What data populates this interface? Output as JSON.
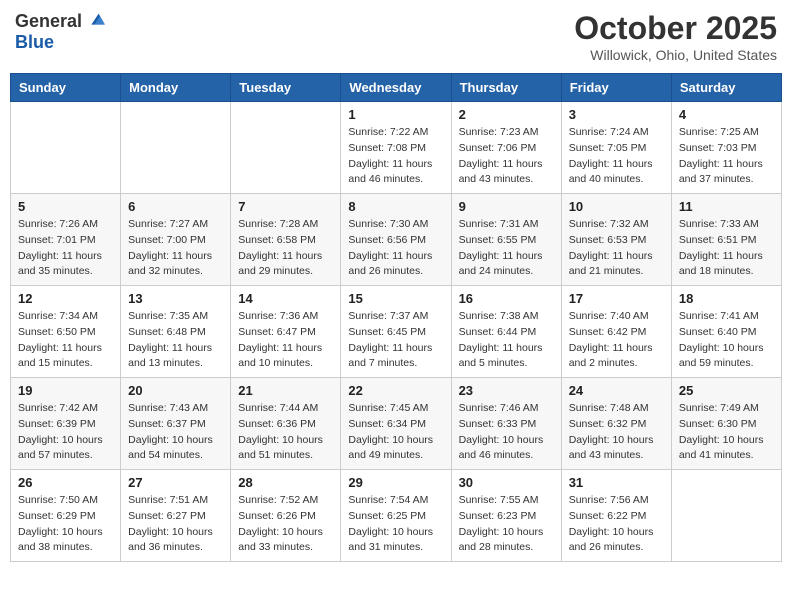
{
  "logo": {
    "general": "General",
    "blue": "Blue"
  },
  "header": {
    "month": "October 2025",
    "location": "Willowick, Ohio, United States"
  },
  "weekdays": [
    "Sunday",
    "Monday",
    "Tuesday",
    "Wednesday",
    "Thursday",
    "Friday",
    "Saturday"
  ],
  "weeks": [
    [
      {
        "day": "",
        "sunrise": "",
        "sunset": "",
        "daylight": ""
      },
      {
        "day": "",
        "sunrise": "",
        "sunset": "",
        "daylight": ""
      },
      {
        "day": "",
        "sunrise": "",
        "sunset": "",
        "daylight": ""
      },
      {
        "day": "1",
        "sunrise": "Sunrise: 7:22 AM",
        "sunset": "Sunset: 7:08 PM",
        "daylight": "Daylight: 11 hours and 46 minutes."
      },
      {
        "day": "2",
        "sunrise": "Sunrise: 7:23 AM",
        "sunset": "Sunset: 7:06 PM",
        "daylight": "Daylight: 11 hours and 43 minutes."
      },
      {
        "day": "3",
        "sunrise": "Sunrise: 7:24 AM",
        "sunset": "Sunset: 7:05 PM",
        "daylight": "Daylight: 11 hours and 40 minutes."
      },
      {
        "day": "4",
        "sunrise": "Sunrise: 7:25 AM",
        "sunset": "Sunset: 7:03 PM",
        "daylight": "Daylight: 11 hours and 37 minutes."
      }
    ],
    [
      {
        "day": "5",
        "sunrise": "Sunrise: 7:26 AM",
        "sunset": "Sunset: 7:01 PM",
        "daylight": "Daylight: 11 hours and 35 minutes."
      },
      {
        "day": "6",
        "sunrise": "Sunrise: 7:27 AM",
        "sunset": "Sunset: 7:00 PM",
        "daylight": "Daylight: 11 hours and 32 minutes."
      },
      {
        "day": "7",
        "sunrise": "Sunrise: 7:28 AM",
        "sunset": "Sunset: 6:58 PM",
        "daylight": "Daylight: 11 hours and 29 minutes."
      },
      {
        "day": "8",
        "sunrise": "Sunrise: 7:30 AM",
        "sunset": "Sunset: 6:56 PM",
        "daylight": "Daylight: 11 hours and 26 minutes."
      },
      {
        "day": "9",
        "sunrise": "Sunrise: 7:31 AM",
        "sunset": "Sunset: 6:55 PM",
        "daylight": "Daylight: 11 hours and 24 minutes."
      },
      {
        "day": "10",
        "sunrise": "Sunrise: 7:32 AM",
        "sunset": "Sunset: 6:53 PM",
        "daylight": "Daylight: 11 hours and 21 minutes."
      },
      {
        "day": "11",
        "sunrise": "Sunrise: 7:33 AM",
        "sunset": "Sunset: 6:51 PM",
        "daylight": "Daylight: 11 hours and 18 minutes."
      }
    ],
    [
      {
        "day": "12",
        "sunrise": "Sunrise: 7:34 AM",
        "sunset": "Sunset: 6:50 PM",
        "daylight": "Daylight: 11 hours and 15 minutes."
      },
      {
        "day": "13",
        "sunrise": "Sunrise: 7:35 AM",
        "sunset": "Sunset: 6:48 PM",
        "daylight": "Daylight: 11 hours and 13 minutes."
      },
      {
        "day": "14",
        "sunrise": "Sunrise: 7:36 AM",
        "sunset": "Sunset: 6:47 PM",
        "daylight": "Daylight: 11 hours and 10 minutes."
      },
      {
        "day": "15",
        "sunrise": "Sunrise: 7:37 AM",
        "sunset": "Sunset: 6:45 PM",
        "daylight": "Daylight: 11 hours and 7 minutes."
      },
      {
        "day": "16",
        "sunrise": "Sunrise: 7:38 AM",
        "sunset": "Sunset: 6:44 PM",
        "daylight": "Daylight: 11 hours and 5 minutes."
      },
      {
        "day": "17",
        "sunrise": "Sunrise: 7:40 AM",
        "sunset": "Sunset: 6:42 PM",
        "daylight": "Daylight: 11 hours and 2 minutes."
      },
      {
        "day": "18",
        "sunrise": "Sunrise: 7:41 AM",
        "sunset": "Sunset: 6:40 PM",
        "daylight": "Daylight: 10 hours and 59 minutes."
      }
    ],
    [
      {
        "day": "19",
        "sunrise": "Sunrise: 7:42 AM",
        "sunset": "Sunset: 6:39 PM",
        "daylight": "Daylight: 10 hours and 57 minutes."
      },
      {
        "day": "20",
        "sunrise": "Sunrise: 7:43 AM",
        "sunset": "Sunset: 6:37 PM",
        "daylight": "Daylight: 10 hours and 54 minutes."
      },
      {
        "day": "21",
        "sunrise": "Sunrise: 7:44 AM",
        "sunset": "Sunset: 6:36 PM",
        "daylight": "Daylight: 10 hours and 51 minutes."
      },
      {
        "day": "22",
        "sunrise": "Sunrise: 7:45 AM",
        "sunset": "Sunset: 6:34 PM",
        "daylight": "Daylight: 10 hours and 49 minutes."
      },
      {
        "day": "23",
        "sunrise": "Sunrise: 7:46 AM",
        "sunset": "Sunset: 6:33 PM",
        "daylight": "Daylight: 10 hours and 46 minutes."
      },
      {
        "day": "24",
        "sunrise": "Sunrise: 7:48 AM",
        "sunset": "Sunset: 6:32 PM",
        "daylight": "Daylight: 10 hours and 43 minutes."
      },
      {
        "day": "25",
        "sunrise": "Sunrise: 7:49 AM",
        "sunset": "Sunset: 6:30 PM",
        "daylight": "Daylight: 10 hours and 41 minutes."
      }
    ],
    [
      {
        "day": "26",
        "sunrise": "Sunrise: 7:50 AM",
        "sunset": "Sunset: 6:29 PM",
        "daylight": "Daylight: 10 hours and 38 minutes."
      },
      {
        "day": "27",
        "sunrise": "Sunrise: 7:51 AM",
        "sunset": "Sunset: 6:27 PM",
        "daylight": "Daylight: 10 hours and 36 minutes."
      },
      {
        "day": "28",
        "sunrise": "Sunrise: 7:52 AM",
        "sunset": "Sunset: 6:26 PM",
        "daylight": "Daylight: 10 hours and 33 minutes."
      },
      {
        "day": "29",
        "sunrise": "Sunrise: 7:54 AM",
        "sunset": "Sunset: 6:25 PM",
        "daylight": "Daylight: 10 hours and 31 minutes."
      },
      {
        "day": "30",
        "sunrise": "Sunrise: 7:55 AM",
        "sunset": "Sunset: 6:23 PM",
        "daylight": "Daylight: 10 hours and 28 minutes."
      },
      {
        "day": "31",
        "sunrise": "Sunrise: 7:56 AM",
        "sunset": "Sunset: 6:22 PM",
        "daylight": "Daylight: 10 hours and 26 minutes."
      },
      {
        "day": "",
        "sunrise": "",
        "sunset": "",
        "daylight": ""
      }
    ]
  ]
}
